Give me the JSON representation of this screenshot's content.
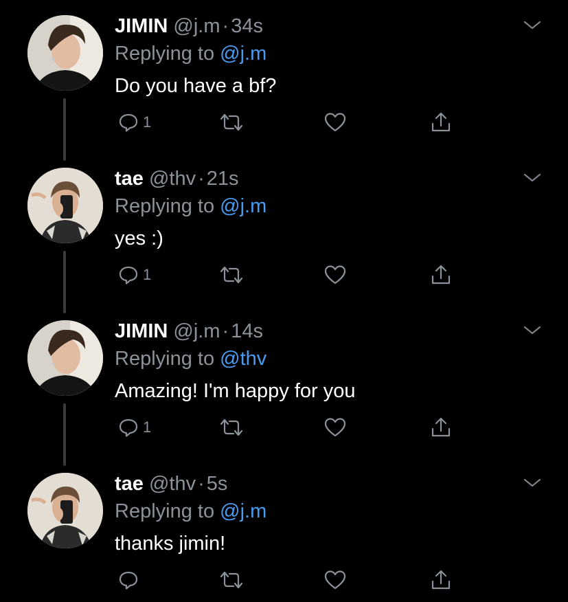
{
  "thread": [
    {
      "name": "JIMIN",
      "handle": "@j.m",
      "time": "34s",
      "reply_prefix": "Replying to ",
      "reply_to": "@j.m",
      "text": "Do you have a bf?",
      "reply_count": "1",
      "avatar": "jimin-avatar"
    },
    {
      "name": "tae",
      "handle": "@thv",
      "time": "21s",
      "reply_prefix": "Replying to ",
      "reply_to": "@j.m",
      "text": "yes :)",
      "reply_count": "1",
      "avatar": "tae-avatar"
    },
    {
      "name": "JIMIN",
      "handle": "@j.m",
      "time": "14s",
      "reply_prefix": "Replying to ",
      "reply_to": "@thv",
      "text": "Amazing! I'm happy for you",
      "reply_count": "1",
      "avatar": "jimin-avatar"
    },
    {
      "name": "tae",
      "handle": "@thv",
      "time": "5s",
      "reply_prefix": "Replying to ",
      "reply_to": "@j.m",
      "text": "thanks jimin!",
      "reply_count": "",
      "avatar": "tae-avatar"
    }
  ],
  "separator": "·",
  "colors": {
    "background": "#000000",
    "text": "#ffffff",
    "muted": "#8b9299",
    "accent": "#4a9bef",
    "thread_line": "#3a3a3a"
  },
  "icons": [
    "chevron-down-icon",
    "reply-icon",
    "retweet-icon",
    "like-icon",
    "share-icon"
  ]
}
